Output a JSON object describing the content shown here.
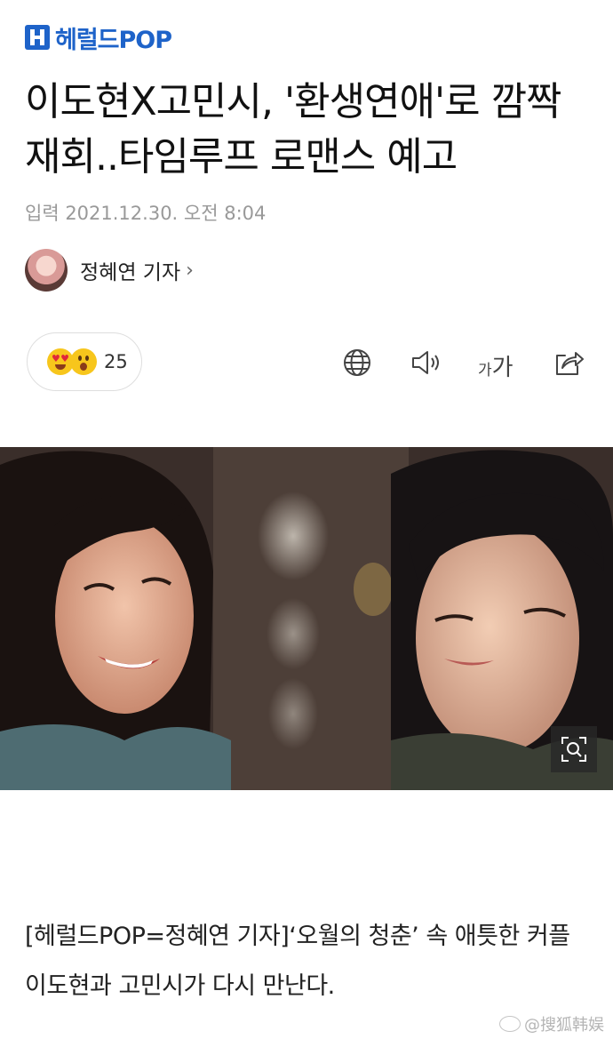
{
  "header": {
    "logo_text": "헤럴드POP",
    "brand_color": "#1e63c9"
  },
  "article": {
    "title": "이도현X고민시, '환생연애'로 깜짝 재회..타임루프 로맨스 예고",
    "date": "입력 2021.12.30. 오전 8:04",
    "author": "정혜연 기자",
    "author_chevron": "›",
    "body": "[헤럴드POP=정혜연 기자]‘오월의 청춘’ 속 애틋한 커플 이도현과 고민시가 다시 만난다."
  },
  "reactions": {
    "count": "25",
    "emojis": [
      "heart-eyes-emoji",
      "surprised-emoji"
    ]
  },
  "toolbar": {
    "icons": [
      "globe-icon",
      "speaker-icon",
      "font-size-icon",
      "share-icon"
    ],
    "font_size_small": "가",
    "font_size_large": "가"
  },
  "photo": {
    "zoom_icon": "zoom-icon"
  },
  "watermark": {
    "text": "@搜狐韩娱"
  }
}
